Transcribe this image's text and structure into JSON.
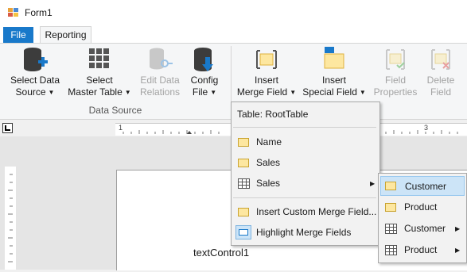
{
  "window": {
    "title": "Form1"
  },
  "tabs": {
    "file": "File",
    "reporting": "Reporting"
  },
  "ribbon": {
    "data_source_group": {
      "label": "Data Source",
      "buttons": [
        {
          "line1": "Select Data",
          "line2": "Source"
        },
        {
          "line1": "Select",
          "line2": "Master Table"
        },
        {
          "line1": "Edit Data",
          "line2": "Relations"
        },
        {
          "line1": "Config",
          "line2": "File"
        }
      ]
    },
    "fields_group": {
      "buttons": [
        {
          "line1": "Insert",
          "line2": "Merge Field"
        },
        {
          "line1": "Insert",
          "line2": "Special Field"
        },
        {
          "line1": "Field",
          "line2": "Properties"
        },
        {
          "line1": "Delete",
          "line2": "Field"
        }
      ]
    }
  },
  "ruler": {
    "mark1": "1",
    "mark3": "3"
  },
  "document": {
    "text": "textControl1"
  },
  "merge_menu": {
    "header": "Table: RootTable",
    "items": [
      {
        "label": "Name",
        "icon": "field-icon"
      },
      {
        "label": "Sales",
        "icon": "field-icon"
      },
      {
        "label": "Sales",
        "icon": "table-icon"
      },
      {
        "label": "Insert Custom Merge Field...",
        "icon": "field-icon"
      },
      {
        "label": "Highlight Merge Fields",
        "icon": "highlight-icon"
      }
    ]
  },
  "submenu": {
    "items": [
      {
        "label": "Customer",
        "icon": "field-icon"
      },
      {
        "label": "Product",
        "icon": "field-icon"
      },
      {
        "label": "Customer",
        "icon": "table-icon"
      },
      {
        "label": "Product",
        "icon": "table-icon"
      }
    ]
  },
  "colors": {
    "accent": "#1979ca",
    "highlight": "#cce4f7",
    "field": "#fde7a0"
  }
}
